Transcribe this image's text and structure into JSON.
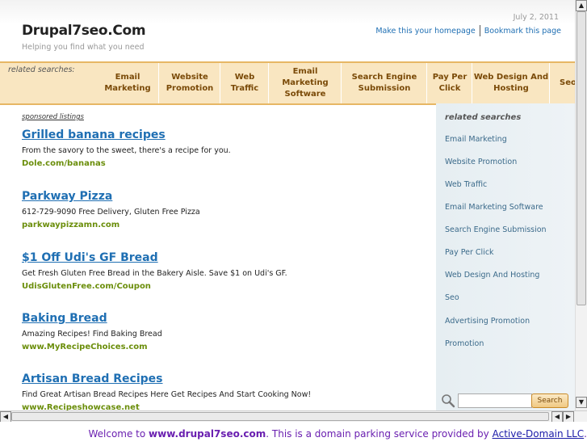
{
  "header": {
    "site_title": "Drupal7seo.Com",
    "tagline": "Helping you find what you need",
    "date": "July 2, 2011",
    "links": [
      "Make this your homepage",
      "Bookmark this page"
    ]
  },
  "nav": {
    "label": "related searches:",
    "items": [
      "Email Marketing",
      "Website Promotion",
      "Web Traffic",
      "Email Marketing Software",
      "Search Engine Submission",
      "Pay Per Click",
      "Web Design And Hosting",
      "Seo"
    ]
  },
  "content": {
    "sponsored_label": "sponsored listings",
    "ads": [
      {
        "title": "Grilled banana recipes",
        "desc": "From the savory to the sweet, there's a recipe for you.",
        "url": "Dole.com/bananas"
      },
      {
        "title": "Parkway Pizza",
        "desc": "612-729-9090 Free Delivery, Gluten Free Pizza",
        "url": "parkwaypizzamn.com"
      },
      {
        "title": "$1 Off Udi's GF Bread",
        "desc": "Get Fresh Gluten Free Bread in the Bakery Aisle. Save $1 on Udi's GF.",
        "url": "UdisGlutenFree.com/Coupon"
      },
      {
        "title": "Baking Bread",
        "desc": "Amazing Recipes! Find Baking Bread",
        "url": "www.MyRecipeChoices.com"
      },
      {
        "title": "Artisan Bread Recipes",
        "desc": "Find Great Artisan Bread Recipes Here Get Recipes And Start Cooking Now!",
        "url": "www.Recipeshowcase.net"
      }
    ]
  },
  "sidebar": {
    "title": "related searches",
    "items": [
      "Email Marketing",
      "Website Promotion",
      "Web Traffic",
      "Email Marketing Software",
      "Search Engine Submission",
      "Pay Per Click",
      "Web Design And Hosting",
      "Seo",
      "Advertising Promotion",
      "Promotion"
    ],
    "search_value": "",
    "search_button": "Search"
  },
  "footer": {
    "prefix": "Welcome to ",
    "domain": "www.drupal7seo.com",
    "middle": ". This is a domain parking service provided by ",
    "provider": "Active-Domain LLC",
    "suffix": "."
  },
  "colors": {
    "accent_link": "#1f6fb3",
    "ad_url": "#6b8e0b",
    "nav_bg": "#f9e6c1",
    "nav_text": "#7a4a08",
    "footer_text": "#6a1fb0"
  },
  "icons": {
    "search": "magnifier-icon",
    "scroll_up": "arrow-up-icon",
    "scroll_down": "arrow-down-icon",
    "scroll_left": "arrow-left-icon",
    "scroll_right": "arrow-right-icon"
  }
}
